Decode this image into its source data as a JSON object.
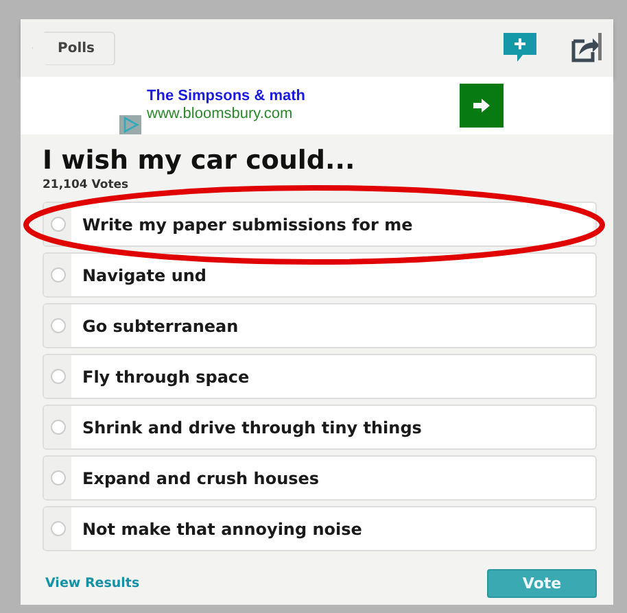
{
  "header": {
    "back_button": "Polls"
  },
  "ad": {
    "title": "The Simpsons & math",
    "url": "www.bloomsbury.com"
  },
  "poll": {
    "title": "I wish my car could...",
    "votes": "21,104 Votes"
  },
  "options": [
    {
      "label": "Write my paper submissions for me",
      "selected": false
    },
    {
      "label": "Navigate und",
      "selected": false
    },
    {
      "label": "Go subterranean",
      "selected": false
    },
    {
      "label": "Fly through space",
      "selected": false
    },
    {
      "label": "Shrink and drive through tiny things",
      "selected": false
    },
    {
      "label": "Expand and crush houses",
      "selected": false
    },
    {
      "label": "Not make that annoying noise",
      "selected": false
    }
  ],
  "footer": {
    "link": "View Results",
    "vote_button": {
      "label": "Vote",
      "disabled": true
    }
  }
}
